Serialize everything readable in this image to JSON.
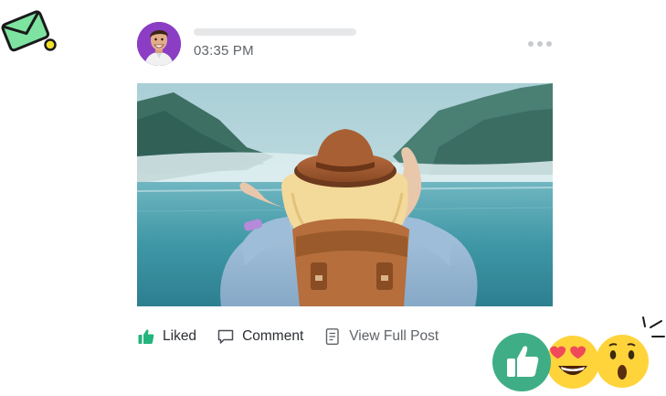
{
  "post": {
    "timestamp": "03:35 PM",
    "actions": {
      "like": {
        "label": "Liked",
        "icon": "thumbs-up-icon",
        "active_color": "#24b47e"
      },
      "comment": {
        "label": "Comment",
        "icon": "comment-icon"
      },
      "view_full": {
        "label": "View Full Post",
        "icon": "document-icon"
      }
    }
  },
  "reactions": [
    "thumbs-up",
    "heart-eyes",
    "surprised"
  ],
  "colors": {
    "accent_green": "#24b47e",
    "envelope_green": "#7ee3a0",
    "badge_yellow": "#f2e12a",
    "reaction_yellow": "#ffd43b"
  }
}
